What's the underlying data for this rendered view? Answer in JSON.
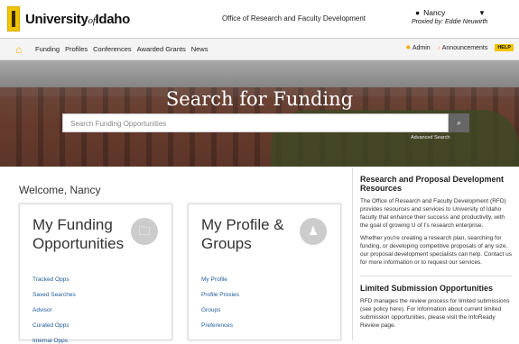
{
  "header": {
    "logo_main": "University",
    "logo_small": "of",
    "logo_end": "Idaho",
    "office": "Office of Research and Faculty Development",
    "user_name": "Nancy",
    "proxied": "Proxied by: Eddie Neuwirth"
  },
  "nav": {
    "items": [
      "Funding",
      "Profiles",
      "Conferences",
      "Awarded Grants",
      "News"
    ],
    "admin": "Admin",
    "announcements": "Announcements",
    "help": "HELP"
  },
  "hero": {
    "title": "Search for Funding",
    "placeholder": "Search Funding Opportunities",
    "advanced": "Advanced Search"
  },
  "main": {
    "welcome": "Welcome, Nancy",
    "card1": {
      "title": "My Funding Opportunities",
      "links": [
        "Tracked Opps",
        "Saved Searches",
        "Advisor",
        "Curated Opps",
        "Internal Opps"
      ]
    },
    "card2": {
      "title": "My Profile & Groups",
      "links": [
        "My Profile",
        "Profile Proxies",
        "Groups",
        "Preferences"
      ]
    }
  },
  "side": {
    "h1": "Research and Proposal Development Resources",
    "p1": "The Office of Research and Faculty Development (RFD) provides resources and services to University of Idaho faculty that enhance their success and productivity, with the goal of growing U of I's research enterprise.",
    "p2": "Whether you're creating a research plan, searching for funding, or developing competitive proposals of any size, our proposal development specialists can help. Contact us for more information or to request our services.",
    "h2": "Limited Submission Opportunities",
    "p3": "RFD manages the review process for limited submissions (see policy here). For information about current limited submission opportunities, please visit the InfoReady Review page."
  }
}
